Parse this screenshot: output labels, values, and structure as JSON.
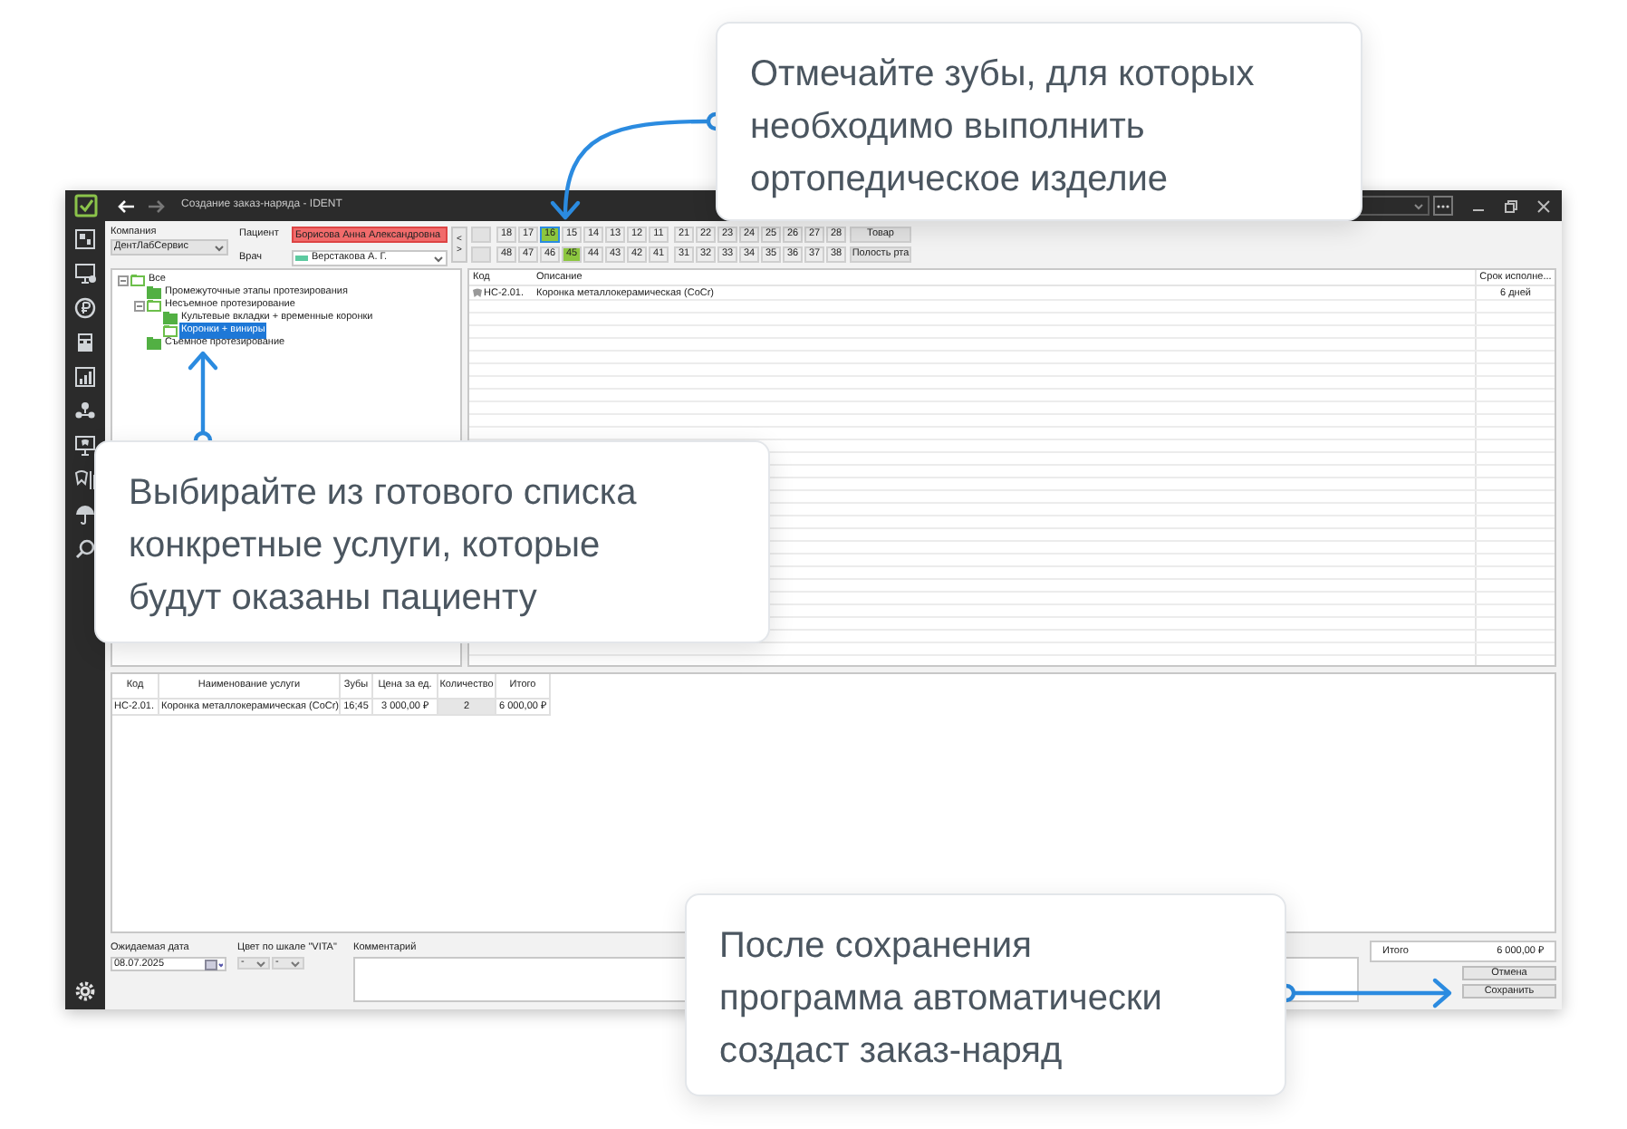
{
  "window": {
    "title": "Создание заказ-наряда - IDENT"
  },
  "order_form": {
    "company_label": "Компания",
    "company": "ДентЛабСервис",
    "patient_label": "Пациент",
    "patient": "Борисова Анна Александровна",
    "doctor_label": "Врач",
    "doctor": "Верстакова А. Г.",
    "nav_arrows": [
      "<",
      ">"
    ]
  },
  "teeth": {
    "upper": [
      {
        "kind": "blank"
      },
      {
        "kind": "tooth",
        "label": "18",
        "selected": false,
        "focused": false
      },
      {
        "kind": "tooth",
        "label": "17",
        "selected": false,
        "focused": false
      },
      {
        "kind": "tooth",
        "label": "16",
        "selected": true,
        "focused": true
      },
      {
        "kind": "tooth",
        "label": "15",
        "selected": false,
        "focused": false
      },
      {
        "kind": "tooth",
        "label": "14",
        "selected": false,
        "focused": false
      },
      {
        "kind": "tooth",
        "label": "13",
        "selected": false,
        "focused": false
      },
      {
        "kind": "tooth",
        "label": "12",
        "selected": false,
        "focused": false
      },
      {
        "kind": "tooth",
        "label": "11",
        "selected": false,
        "focused": false
      },
      {
        "kind": "tooth",
        "label": "21",
        "selected": false,
        "focused": false
      },
      {
        "kind": "tooth",
        "label": "22",
        "selected": false,
        "focused": false
      },
      {
        "kind": "tooth",
        "label": "23",
        "selected": false,
        "focused": false
      },
      {
        "kind": "tooth",
        "label": "24",
        "selected": false,
        "focused": false
      },
      {
        "kind": "tooth",
        "label": "25",
        "selected": false,
        "focused": false
      },
      {
        "kind": "tooth",
        "label": "26",
        "selected": false,
        "focused": false
      },
      {
        "kind": "tooth",
        "label": "27",
        "selected": false,
        "focused": false
      },
      {
        "kind": "tooth",
        "label": "28",
        "selected": false,
        "focused": false
      }
    ],
    "upper_button": "Товар",
    "lower": [
      {
        "kind": "blank"
      },
      {
        "kind": "tooth",
        "label": "48",
        "selected": false,
        "focused": false
      },
      {
        "kind": "tooth",
        "label": "47",
        "selected": false,
        "focused": false
      },
      {
        "kind": "tooth",
        "label": "46",
        "selected": false,
        "focused": false
      },
      {
        "kind": "tooth",
        "label": "45",
        "selected": true,
        "focused": false
      },
      {
        "kind": "tooth",
        "label": "44",
        "selected": false,
        "focused": false
      },
      {
        "kind": "tooth",
        "label": "43",
        "selected": false,
        "focused": false
      },
      {
        "kind": "tooth",
        "label": "42",
        "selected": false,
        "focused": false
      },
      {
        "kind": "tooth",
        "label": "41",
        "selected": false,
        "focused": false
      },
      {
        "kind": "tooth",
        "label": "31",
        "selected": false,
        "focused": false
      },
      {
        "kind": "tooth",
        "label": "32",
        "selected": false,
        "focused": false
      },
      {
        "kind": "tooth",
        "label": "33",
        "selected": false,
        "focused": false
      },
      {
        "kind": "tooth",
        "label": "34",
        "selected": false,
        "focused": false
      },
      {
        "kind": "tooth",
        "label": "35",
        "selected": false,
        "focused": false
      },
      {
        "kind": "tooth",
        "label": "36",
        "selected": false,
        "focused": false
      },
      {
        "kind": "tooth",
        "label": "37",
        "selected": false,
        "focused": false
      },
      {
        "kind": "tooth",
        "label": "38",
        "selected": false,
        "focused": false
      }
    ],
    "lower_button": "Полость рта"
  },
  "tree": [
    {
      "label": "Все",
      "expanded": true,
      "selected": false,
      "children": [
        {
          "label": "Промежуточные этапы протезирования",
          "expanded": false,
          "selected": false
        },
        {
          "label": "Несъемное протезирование",
          "expanded": true,
          "selected": false,
          "children": [
            {
              "label": "Культевые вкладки + временные коронки",
              "expanded": false,
              "selected": false
            },
            {
              "label": "Коронки + виниры",
              "expanded": false,
              "selected": true
            }
          ]
        },
        {
          "label": "Съемное протезирование",
          "expanded": false,
          "selected": false
        }
      ]
    }
  ],
  "services_table": {
    "columns": [
      "Код",
      "Описание",
      "Срок исполне..."
    ],
    "rows": [
      {
        "code": "НС-2.01.",
        "description": "Коронка металлокерамическая (CoCr)",
        "term": "6 дней"
      }
    ]
  },
  "order_table": {
    "columns": [
      "Код",
      "Наименование услуги",
      "Зубы",
      "Цена за ед.",
      "Количество",
      "Итого"
    ],
    "rows": [
      {
        "code": "НС-2.01.",
        "name": "Коронка металлокерамическая (CoCr)",
        "teeth": "16;45",
        "price": "3 000,00 ₽",
        "quantity": "2",
        "total": "6 000,00 ₽"
      }
    ]
  },
  "footer": {
    "date_label": "Ожидаемая дата",
    "date": "08.07.2025",
    "vita_label": "Цвет по шкале \"VITA\"",
    "vita_values": [
      "-",
      "-"
    ],
    "comment_label": "Комментарий",
    "total_label": "Итого",
    "total": "6 000,00 ₽",
    "cancel": "Отмена",
    "save": "Сохранить"
  },
  "callouts": [
    {
      "lines": [
        "Отмечайте зубы, для которых",
        "необходимо выполнить",
        "ортопедическое изделие"
      ]
    },
    {
      "lines": [
        "Выбирайте из готового списка",
        "конкретные услуги, которые",
        "будут оказаны пациенту"
      ]
    },
    {
      "lines": [
        "После сохранения",
        "программа автоматически",
        "создаст заказ-наряд"
      ]
    }
  ]
}
